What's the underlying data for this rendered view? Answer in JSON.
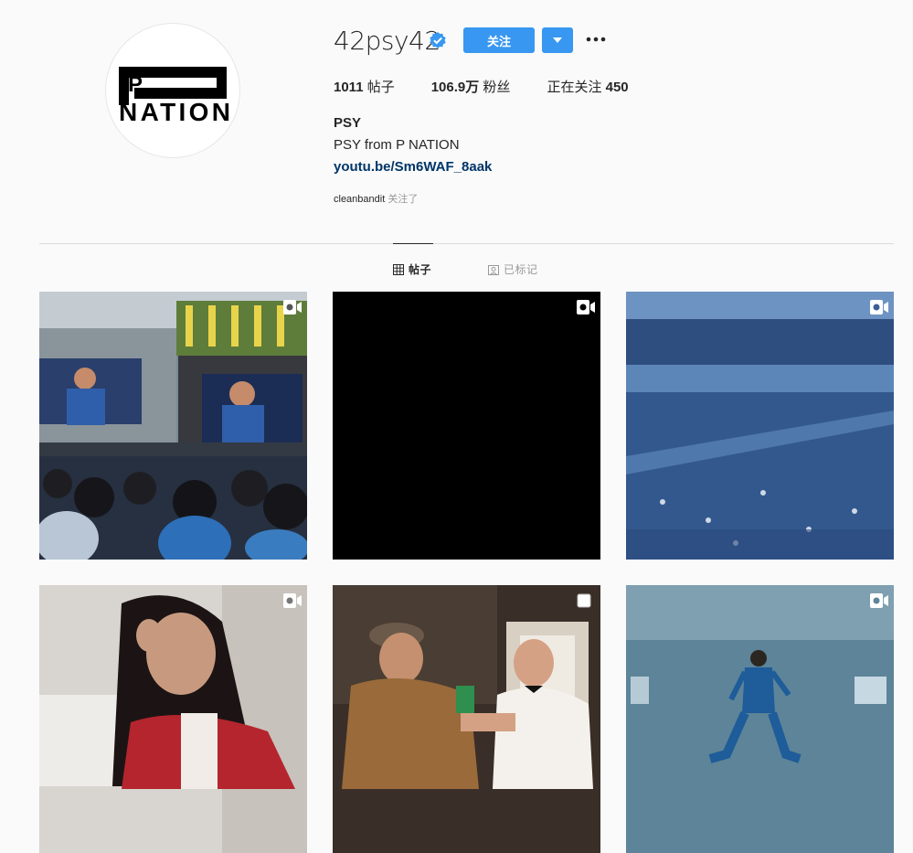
{
  "profile": {
    "username": "42psy42",
    "follow_label": "关注",
    "fullname": "PSY",
    "bio": "PSY from P NATION",
    "link": "youtu.be/Sm6WAF_8aak",
    "followed_by_user": "cleanbandit",
    "followed_by_suffix": " 关注了",
    "logo_text_top": "P",
    "logo_text_bottom": "NATION"
  },
  "stats": {
    "posts_count": "1011",
    "posts_label": " 帖子",
    "followers_count": "106.9万",
    "followers_label": " 粉丝",
    "following_label": "正在关注 ",
    "following_count": "450"
  },
  "tabs": {
    "posts": "帖子",
    "tagged": "已标记"
  },
  "colors": {
    "accent": "#3897f0",
    "link": "#003569",
    "divider": "#dbdbdb"
  },
  "posts": [
    {
      "type": "video",
      "icon": "video-icon",
      "scene": "concert-stage"
    },
    {
      "type": "video",
      "icon": "video-icon",
      "scene": "black"
    },
    {
      "type": "video",
      "icon": "video-icon",
      "scene": "stadium-crowd"
    },
    {
      "type": "video",
      "icon": "video-icon",
      "scene": "woman-portrait"
    },
    {
      "type": "carousel",
      "icon": "carousel-icon",
      "scene": "backstage"
    },
    {
      "type": "video",
      "icon": "video-icon",
      "scene": "dancer-stage"
    }
  ]
}
